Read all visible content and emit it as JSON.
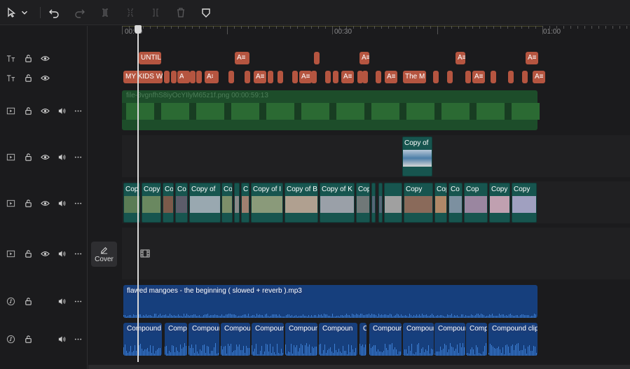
{
  "toolbar": {
    "buttons": [
      {
        "name": "select-pointer-icon",
        "enabled": true
      },
      {
        "name": "chevron-down-icon",
        "enabled": true
      },
      {
        "name": "undo-icon",
        "enabled": true
      },
      {
        "name": "redo-icon",
        "enabled": false
      },
      {
        "name": "split-icon",
        "enabled": false
      },
      {
        "name": "split-left-icon",
        "enabled": false
      },
      {
        "name": "split-right-icon",
        "enabled": false
      },
      {
        "name": "delete-icon",
        "enabled": false
      },
      {
        "name": "shield-icon",
        "enabled": true
      }
    ]
  },
  "ruler": {
    "labels": [
      "00:00",
      "00:30",
      "01:00"
    ]
  },
  "cover": {
    "label": "Cover"
  },
  "tracks": {
    "text1": {
      "clips": [
        "UNTIL",
        "A≡",
        "",
        "A≡",
        "A≡",
        "A≡"
      ]
    },
    "text2": {
      "first_label": "MY KIDS W",
      "mid_label": "The M",
      "small_label": "A≡"
    },
    "overlay1": {
      "label": "file-3vgnfhS8iyOcYIlyM65z1f.png   00:00:59:13"
    },
    "overlay2": {
      "label": "Copy of"
    },
    "main_video": {
      "labels": [
        "Cop",
        "Copy",
        "Co",
        "Co",
        "Copy of",
        "Co",
        "C",
        "Copy of I",
        "Copy of B",
        "Copy of K",
        "Cop",
        "",
        "Copy",
        "Copy of",
        "Co",
        "Cop",
        "Copy",
        "Copy",
        "Copy o"
      ]
    },
    "audio1": {
      "label": "flawed mangoes - the beginning ( slowed + reverb ).mp3"
    },
    "audio2": {
      "labels": [
        "Compound",
        "Comp",
        "Compoun",
        "Compou",
        "Compoun",
        "Compoun",
        "Compoun",
        "Co",
        "Compoun",
        "Compoun",
        "Compoun",
        "Comp",
        "Compound clip"
      ]
    }
  },
  "colors": {
    "text_clip": "#b55540",
    "video_clip": "#17554f",
    "audio_clip": "#163f7d",
    "overlay_clip": "#1d4d2a"
  }
}
